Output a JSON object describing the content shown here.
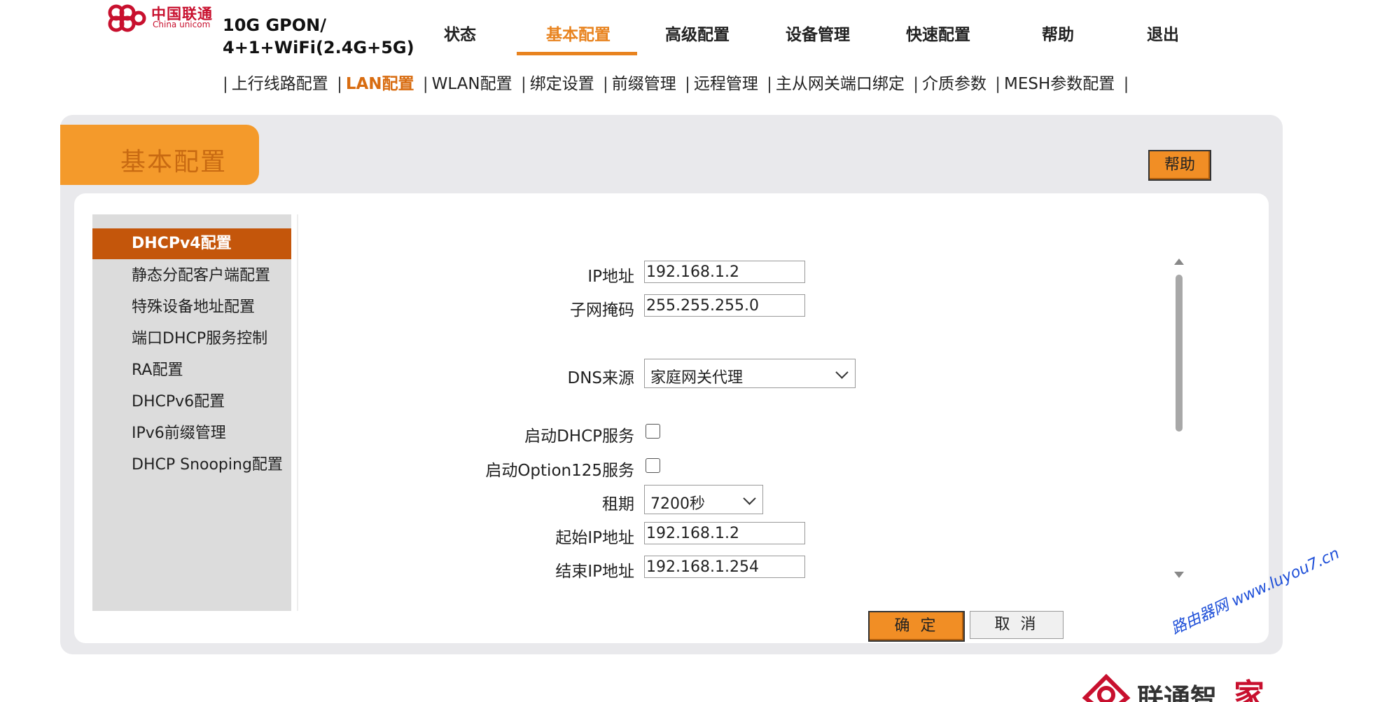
{
  "brand": {
    "logo_cn": "中国联通",
    "logo_en": "China unicom",
    "model_line1": "10G GPON/",
    "model_line2": "4+1+WiFi(2.4G+5G)"
  },
  "main_nav": [
    {
      "label": "状态"
    },
    {
      "label": "基本配置",
      "active": true
    },
    {
      "label": "高级配置"
    },
    {
      "label": "设备管理"
    },
    {
      "label": "快速配置"
    },
    {
      "label": "帮助"
    },
    {
      "label": "退出"
    }
  ],
  "sub_nav": [
    {
      "label": "上行线路配置"
    },
    {
      "label": "LAN配置",
      "active": true
    },
    {
      "label": "WLAN配置"
    },
    {
      "label": "绑定设置"
    },
    {
      "label": "前缀管理"
    },
    {
      "label": "远程管理"
    },
    {
      "label": "主从网关端口绑定"
    },
    {
      "label": "介质参数"
    },
    {
      "label": "MESH参数配置"
    }
  ],
  "separator": "|",
  "page": {
    "title": "基本配置",
    "help_label": "帮助"
  },
  "left_menu": [
    {
      "label": "DHCPv4配置",
      "active": true
    },
    {
      "label": "静态分配客户端配置"
    },
    {
      "label": "特殊设备地址配置"
    },
    {
      "label": "端口DHCP服务控制"
    },
    {
      "label": "RA配置"
    },
    {
      "label": "DHCPv6配置"
    },
    {
      "label": "IPv6前缀管理"
    },
    {
      "label": "DHCP Snooping配置"
    }
  ],
  "form": {
    "ip_label": "IP地址",
    "ip_value": "192.168.1.2",
    "mask_label": "子网掩码",
    "mask_value": "255.255.255.0",
    "dns_label": "DNS来源",
    "dns_value": "家庭网关代理",
    "dhcp_label": "启动DHCP服务",
    "dhcp_checked": false,
    "opt125_label": "启动Option125服务",
    "opt125_checked": false,
    "lease_label": "租期",
    "lease_value": "7200秒",
    "start_label": "起始IP地址",
    "start_value": "192.168.1.2",
    "end_label": "结束IP地址",
    "end_value": "192.168.1.254"
  },
  "buttons": {
    "ok": "确 定",
    "cancel": "取 消"
  },
  "watermark": "路由器网 www.luyou7.cn",
  "footer_logo": {
    "text": "联通智",
    "accent": "家"
  },
  "colors": {
    "accent_orange": "#e8831f",
    "menu_active": "#c4560b",
    "brand_red": "#c8102e"
  }
}
